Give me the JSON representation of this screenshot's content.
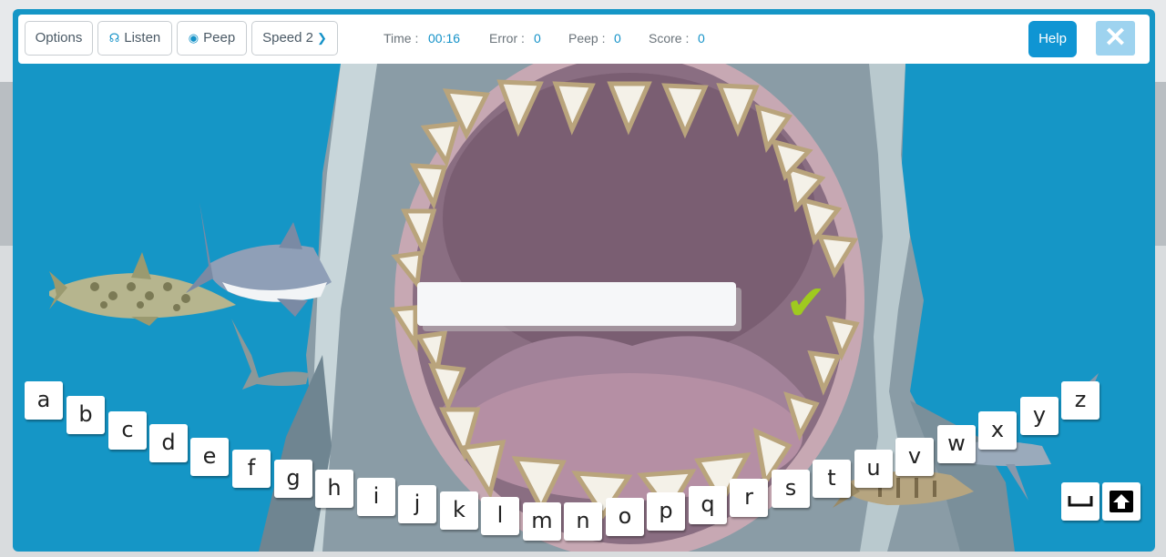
{
  "toolbar": {
    "options_label": "Options",
    "listen_label": "Listen",
    "peep_label": "Peep",
    "speed_label": "Speed 2",
    "time_label": "Time :",
    "time_value": "00:16",
    "error_label": "Error :",
    "error_value": "0",
    "peep_count_label": "Peep :",
    "peep_count_value": "0",
    "score_label": "Score :",
    "score_value": "0",
    "help_label": "Help",
    "close_icon": "close-icon"
  },
  "game": {
    "answer_text": "",
    "correct_icon": "check-icon",
    "keys": [
      "a",
      "b",
      "c",
      "d",
      "e",
      "f",
      "g",
      "h",
      "i",
      "j",
      "k",
      "l",
      "m",
      "n",
      "o",
      "p",
      "q",
      "r",
      "s",
      "t",
      "u",
      "v",
      "w",
      "x",
      "y",
      "z"
    ],
    "space_icon": "space-key-icon",
    "shift_icon": "shift-up-icon"
  },
  "colors": {
    "water": "#1596c6",
    "accent": "#1592c8",
    "tick": "#9fca1f",
    "help": "#0f95d3"
  }
}
